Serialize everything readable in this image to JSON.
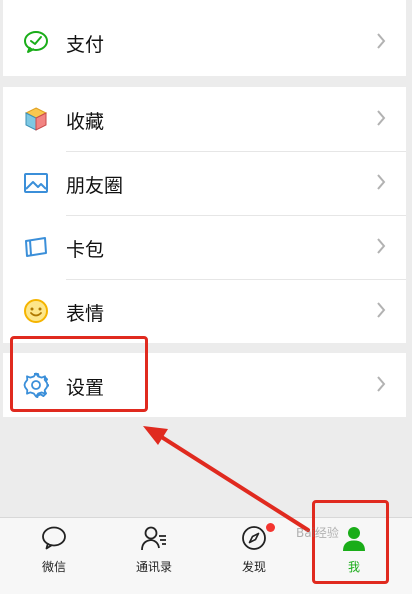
{
  "menu": {
    "pay": "支付",
    "favorites": "收藏",
    "moments": "朋友圈",
    "cards": "卡包",
    "stickers": "表情",
    "settings": "设置"
  },
  "tabbar": {
    "chats": "微信",
    "contacts": "通讯录",
    "discover": "发现",
    "me": "我",
    "active_tab": "me"
  },
  "watermark": "Bai经验",
  "colors": {
    "accent_green": "#1aad19",
    "annotation_red": "#e02a1f",
    "badge_red": "#f43530"
  }
}
